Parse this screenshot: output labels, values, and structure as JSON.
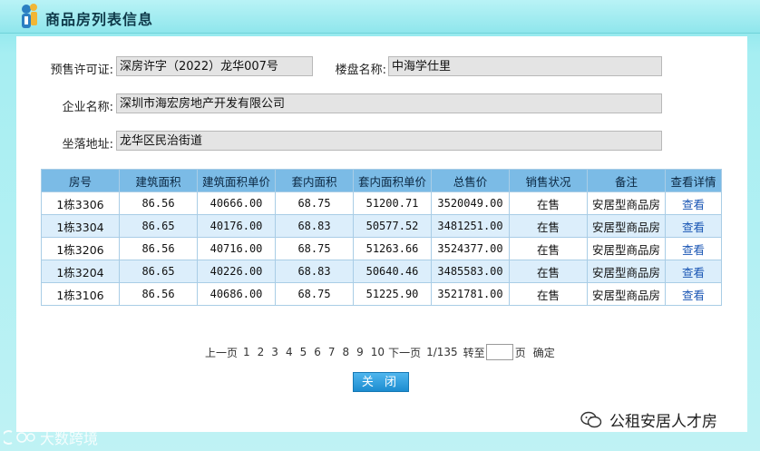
{
  "header": {
    "title": "商品房列表信息"
  },
  "form": {
    "presale_label": "预售许可证:",
    "presale_value": "深房许字（2022）龙华007号",
    "project_label": "楼盘名称:",
    "project_value": "中海学仕里",
    "company_label": "企业名称:",
    "company_value": "深圳市海宏房地产开发有限公司",
    "address_label": "坐落地址:",
    "address_value": "龙华区民治街道"
  },
  "table": {
    "headers": [
      "房号",
      "建筑面积",
      "建筑面积单价",
      "套内面积",
      "套内面积单价",
      "总售价",
      "销售状况",
      "备注",
      "查看详情"
    ],
    "rows": [
      {
        "room": "1栋3306",
        "area": "86.56",
        "area_price": "40666.00",
        "inner": "68.75",
        "inner_price": "51200.71",
        "total": "3520049.00",
        "status": "在售",
        "note": "安居型商品房",
        "view": "查看"
      },
      {
        "room": "1栋3304",
        "area": "86.65",
        "area_price": "40176.00",
        "inner": "68.83",
        "inner_price": "50577.52",
        "total": "3481251.00",
        "status": "在售",
        "note": "安居型商品房",
        "view": "查看"
      },
      {
        "room": "1栋3206",
        "area": "86.56",
        "area_price": "40716.00",
        "inner": "68.75",
        "inner_price": "51263.66",
        "total": "3524377.00",
        "status": "在售",
        "note": "安居型商品房",
        "view": "查看"
      },
      {
        "room": "1栋3204",
        "area": "86.65",
        "area_price": "40226.00",
        "inner": "68.83",
        "inner_price": "50640.46",
        "total": "3485583.00",
        "status": "在售",
        "note": "安居型商品房",
        "view": "查看"
      },
      {
        "room": "1栋3106",
        "area": "86.56",
        "area_price": "40686.00",
        "inner": "68.75",
        "inner_price": "51225.90",
        "total": "3521781.00",
        "status": "在售",
        "note": "安居型商品房",
        "view": "查看"
      }
    ]
  },
  "pager": {
    "prev": "上一页",
    "pages": [
      "1",
      "2",
      "3",
      "4",
      "5",
      "6",
      "7",
      "8",
      "9",
      "10"
    ],
    "current": "1",
    "next": "下一页",
    "count": "1/135",
    "goto_label": "转至",
    "page_suffix": "页",
    "confirm": "确定"
  },
  "close_label": "关 闭",
  "watermarks": {
    "right": "公租安居人才房",
    "left": "大数跨境"
  },
  "colors": {
    "header_bg": "#7bbbe6",
    "even_row": "#dceefb",
    "link": "#1a56b4",
    "button": "#1c8cd0"
  }
}
